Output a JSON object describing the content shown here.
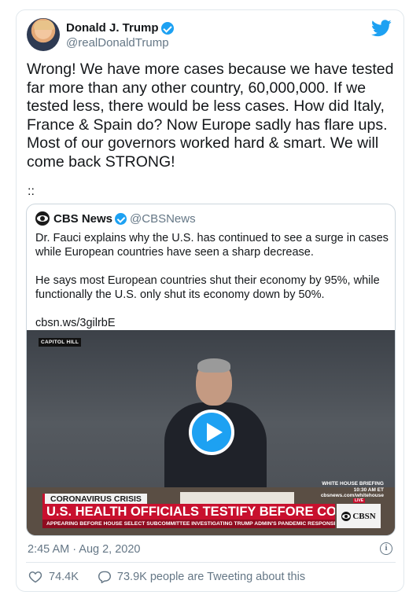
{
  "author": {
    "display_name": "Donald J. Trump",
    "handle": "@realDonaldTrump"
  },
  "tweet": {
    "text": "Wrong! We have more cases because we have tested far more than any other country, 60,000,000. If we tested less, there would be less cases. How did Italy, France & Spain do? Now Europe sadly has flare ups. Most of our governors worked hard & smart. We will come back STRONG!",
    "trailing_mark": "::"
  },
  "quoted": {
    "name": "CBS News",
    "handle": "@CBSNews",
    "text": "Dr. Fauci explains why the U.S. has continued to see a surge in cases while European countries have seen a sharp decrease.\n\nHe says most European countries shut their economy by 95%, while functionally the U.S. only shut its economy down by 50%.\n\ncbsn.ws/3gilrbE",
    "video": {
      "location_tag": "CAPITOL HILL",
      "briefing_lines": [
        "WHITE HOUSE BRIEFING",
        "10:30 AM ET",
        "cbsnews.com/whitehouse"
      ],
      "crisis_tag": "CORONAVIRUS CRISIS",
      "headline": "U.S. HEALTH OFFICIALS TESTIFY BEFORE CONGRESS",
      "subheadline": "APPEARING BEFORE HOUSE SELECT SUBCOMMITTEE INVESTIGATING TRUMP ADMIN'S PANDEMIC RESPONSE",
      "logo_live": "LIVE",
      "logo_text": "CBSN"
    }
  },
  "meta": {
    "timestamp": "2:45 AM · Aug 2, 2020",
    "info_glyph": "i"
  },
  "stats": {
    "likes": "74.4K",
    "tweeting_about": "73.9K people are Tweeting about this"
  },
  "icons": {
    "brand": "twitter-bird-icon",
    "verified": "verified-badge-icon",
    "play": "play-icon",
    "like": "heart-icon",
    "reply": "speech-bubble-icon",
    "info": "info-icon"
  },
  "colors": {
    "brand_blue": "#1da1f2",
    "secondary_text": "#657786",
    "cbs_red": "#c8102e"
  }
}
